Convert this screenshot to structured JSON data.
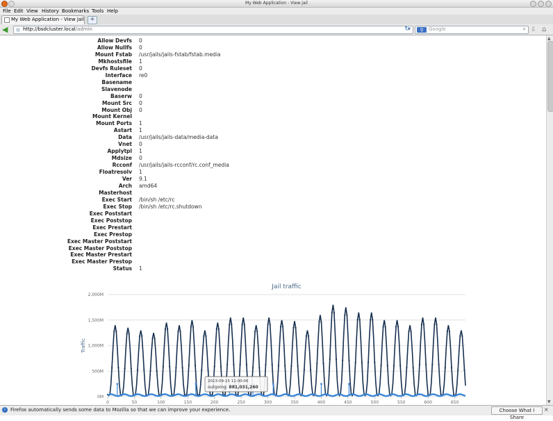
{
  "window": {
    "title": "My Web Application - View jail"
  },
  "menu": [
    "File",
    "Edit",
    "View",
    "History",
    "Bookmarks",
    "Tools",
    "Help"
  ],
  "tab": {
    "label": "My Web Application - View jail",
    "new_tab": "+"
  },
  "nav": {
    "url_host": "http://bsdcluster.local",
    "url_path": "/admin",
    "search_engine": "g",
    "search_placeholder": "Google"
  },
  "properties": [
    {
      "key": "Allow Devfs",
      "value": "0"
    },
    {
      "key": "Allow Nullfs",
      "value": "0"
    },
    {
      "key": "Mount Fstab",
      "value": "/usr/jails/jails-fstab/fstab.media"
    },
    {
      "key": "Mkhostsfile",
      "value": "1"
    },
    {
      "key": "Devfs Ruleset",
      "value": "0"
    },
    {
      "key": "Interface",
      "value": "re0"
    },
    {
      "key": "Basename",
      "value": ""
    },
    {
      "key": "Slavenode",
      "value": ""
    },
    {
      "key": "Baserw",
      "value": "0"
    },
    {
      "key": "Mount Src",
      "value": "0"
    },
    {
      "key": "Mount Obj",
      "value": "0"
    },
    {
      "key": "Mount Kernel",
      "value": ""
    },
    {
      "key": "Mount Ports",
      "value": "1"
    },
    {
      "key": "Astart",
      "value": "1"
    },
    {
      "key": "Data",
      "value": "/usr/jails/jails-data/media-data"
    },
    {
      "key": "Vnet",
      "value": "0"
    },
    {
      "key": "Applytpl",
      "value": "1"
    },
    {
      "key": "Mdsize",
      "value": "0"
    },
    {
      "key": "Rcconf",
      "value": "/usr/jails/jails-rcconf/rc.conf_media"
    },
    {
      "key": "Floatresolv",
      "value": "1"
    },
    {
      "key": "Ver",
      "value": "9.1"
    },
    {
      "key": "Arch",
      "value": "amd64"
    },
    {
      "key": "Masterhost",
      "value": ""
    },
    {
      "key": "Exec Start",
      "value": "/bin/sh /etc/rc"
    },
    {
      "key": "Exec Stop",
      "value": "/bin/sh /etc/rc.shutdown"
    },
    {
      "key": "Exec Poststart",
      "value": ""
    },
    {
      "key": "Exec Poststop",
      "value": ""
    },
    {
      "key": "Exec Prestart",
      "value": ""
    },
    {
      "key": "Exec Prestop",
      "value": ""
    },
    {
      "key": "Exec Master Poststart",
      "value": ""
    },
    {
      "key": "Exec Master Poststop",
      "value": ""
    },
    {
      "key": "Exec Master Prestart",
      "value": ""
    },
    {
      "key": "Exec Master Prestop",
      "value": ""
    },
    {
      "key": "Status",
      "value": "1"
    }
  ],
  "chart_data": {
    "type": "line",
    "title": "Jail traffic",
    "ylabel": "Traffic",
    "xlabel": "",
    "xlim": [
      0,
      670
    ],
    "ylim": [
      0,
      2000000000
    ],
    "x_ticks": [
      "0",
      "50",
      "100",
      "150",
      "200",
      "250",
      "300",
      "350",
      "400",
      "450",
      "500",
      "550",
      "600",
      "650"
    ],
    "y_ticks": [
      "0M",
      "500M",
      "1,000M",
      "1,500M",
      "2,000M"
    ],
    "grid": true,
    "tooltip": {
      "date": "2013-09-15 11:00:00",
      "series": "outgoing",
      "value": "881,031,260"
    },
    "colors": {
      "outgoing": "#17304f",
      "incoming": "#3b86d8"
    },
    "series": [
      {
        "name": "outgoing",
        "peaks_approx": [
          {
            "x": 14,
            "y": 1400000000
          },
          {
            "x": 38,
            "y": 1350000000
          },
          {
            "x": 62,
            "y": 1300000000
          },
          {
            "x": 86,
            "y": 1250000000
          },
          {
            "x": 110,
            "y": 1450000000
          },
          {
            "x": 134,
            "y": 1400000000
          },
          {
            "x": 158,
            "y": 1500000000
          },
          {
            "x": 182,
            "y": 1300000000
          },
          {
            "x": 206,
            "y": 1450000000
          },
          {
            "x": 230,
            "y": 1550000000
          },
          {
            "x": 254,
            "y": 1550000000
          },
          {
            "x": 278,
            "y": 1400000000
          },
          {
            "x": 302,
            "y": 1550000000
          },
          {
            "x": 326,
            "y": 1500000000
          },
          {
            "x": 350,
            "y": 1480000000
          },
          {
            "x": 374,
            "y": 1300000000
          },
          {
            "x": 398,
            "y": 1600000000
          },
          {
            "x": 422,
            "y": 1800000000
          },
          {
            "x": 446,
            "y": 1750000000
          },
          {
            "x": 470,
            "y": 1650000000
          },
          {
            "x": 494,
            "y": 1650000000
          },
          {
            "x": 518,
            "y": 1500000000
          },
          {
            "x": 542,
            "y": 1500000000
          },
          {
            "x": 566,
            "y": 1400000000
          },
          {
            "x": 590,
            "y": 1550000000
          },
          {
            "x": 614,
            "y": 1550000000
          },
          {
            "x": 638,
            "y": 1400000000
          },
          {
            "x": 662,
            "y": 1300000000
          }
        ]
      },
      {
        "name": "incoming",
        "level_approx": 30000000,
        "spikes_to": 250000000
      }
    ]
  },
  "status": {
    "message": "Firefox automatically sends some data to Mozilla so that we can improve your experience.",
    "share_button": "Choose What I Share",
    "close": "×"
  }
}
